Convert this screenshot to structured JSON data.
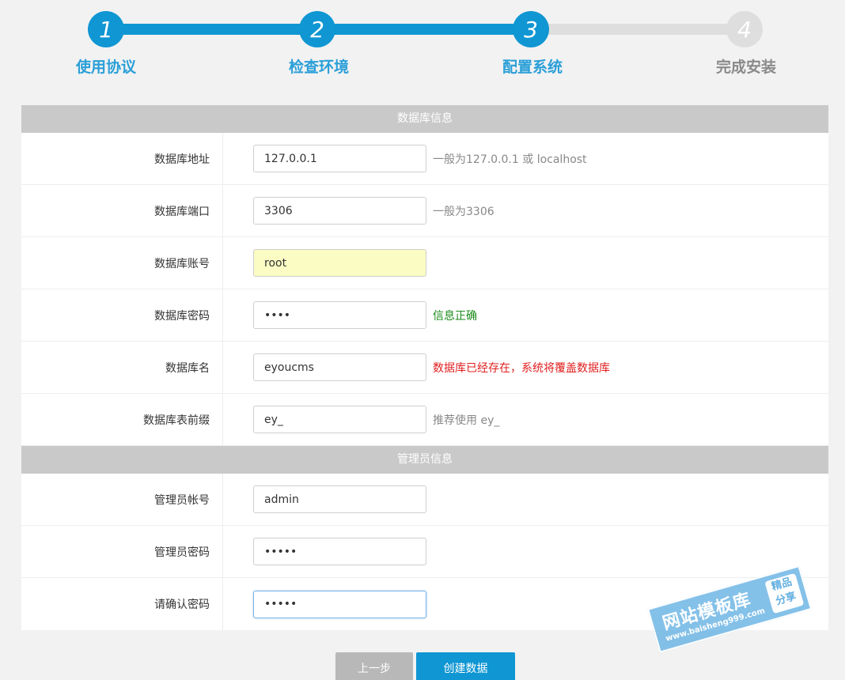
{
  "steps": [
    {
      "number": "1",
      "label": "使用协议",
      "state": "done"
    },
    {
      "number": "2",
      "label": "检查环境",
      "state": "done"
    },
    {
      "number": "3",
      "label": "配置系统",
      "state": "done"
    },
    {
      "number": "4",
      "label": "完成安装",
      "state": "todo"
    }
  ],
  "db_section": {
    "title": "数据库信息",
    "fields": [
      {
        "label": "数据库地址",
        "value": "127.0.0.1",
        "hint": "一般为127.0.0.1 或 localhost"
      },
      {
        "label": "数据库端口",
        "value": "3306",
        "hint": "一般为3306"
      },
      {
        "label": "数据库账号",
        "value": "root",
        "hint": ""
      },
      {
        "label": "数据库密码",
        "value": "••••",
        "hint": "信息正确"
      },
      {
        "label": "数据库名",
        "value": "eyoucms",
        "hint": "数据库已经存在，系统将覆盖数据库"
      },
      {
        "label": "数据库表前缀",
        "value": "ey_",
        "hint": "推荐使用 ey_"
      }
    ]
  },
  "admin_section": {
    "title": "管理员信息",
    "fields": [
      {
        "label": "管理员帐号",
        "value": "admin"
      },
      {
        "label": "管理员密码",
        "value": "•••••"
      },
      {
        "label": "请确认密码",
        "value": "•••••"
      }
    ]
  },
  "buttons": {
    "prev": "上一步",
    "create": "创建数据"
  },
  "watermark": {
    "title": "网站模板库",
    "url": "www.baisheng999.com",
    "badge_line1": "精品",
    "badge_line2": "分享"
  },
  "colors": {
    "accent": "#0f96d3",
    "inactive": "#dedede",
    "ok": "#1a8a1a",
    "warn": "#e02020"
  }
}
